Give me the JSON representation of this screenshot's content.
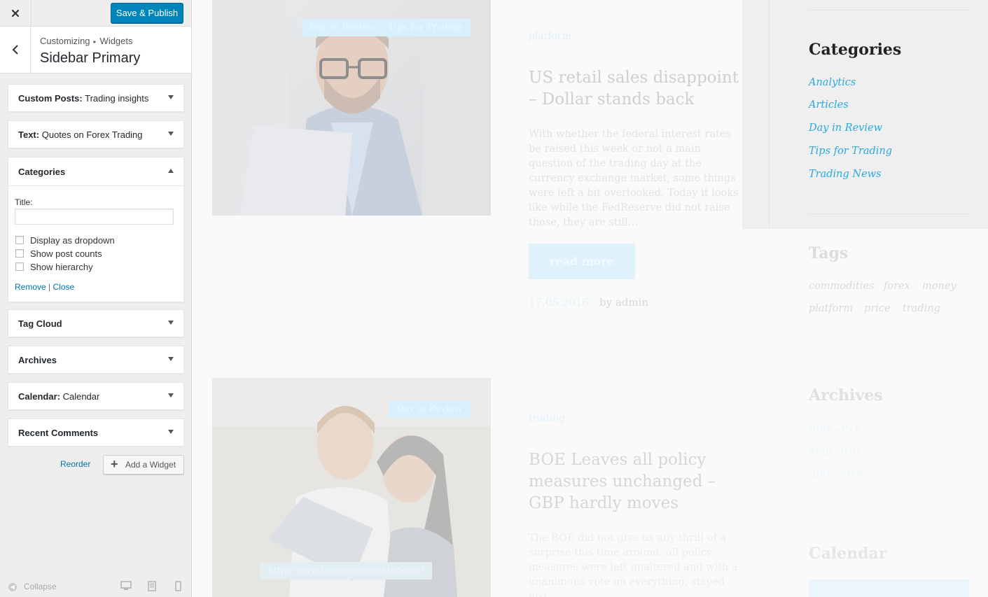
{
  "topbar": {
    "close_icon": "close-icon",
    "publish_label": "Save & Publish"
  },
  "header": {
    "breadcrumb_root": "Customizing",
    "breadcrumb_leaf": "Widgets",
    "title": "Sidebar Primary"
  },
  "widgets": [
    {
      "type": "Custom Posts:",
      "subtitle": " Trading insights"
    },
    {
      "type": "Text:",
      "subtitle": " Quotes on Forex Trading"
    },
    {
      "type": "Categories",
      "subtitle": ""
    },
    {
      "type": "Tag Cloud",
      "subtitle": ""
    },
    {
      "type": "Archives",
      "subtitle": ""
    },
    {
      "type": "Calendar:",
      "subtitle": " Calendar"
    },
    {
      "type": "Recent Comments",
      "subtitle": ""
    }
  ],
  "categories_form": {
    "title_label": "Title:",
    "title_value": "",
    "options": [
      {
        "label": "Display as dropdown",
        "checked": false
      },
      {
        "label": "Show post counts",
        "checked": false
      },
      {
        "label": "Show hierarchy",
        "checked": false
      }
    ],
    "remove_label": "Remove",
    "separator": "|",
    "close_label": "Close"
  },
  "actions": {
    "reorder_label": "Reorder",
    "add_widget_label": "Add a Widget"
  },
  "footer": {
    "collapse_label": "Collapse",
    "devices": [
      "desktop-icon",
      "tablet-icon",
      "mobile-icon"
    ]
  },
  "preview": {
    "post1": {
      "tags": [
        "Day in Review",
        "Tips for Trading"
      ],
      "category": "platform",
      "title": "US retail sales disappoint – Dollar stands back",
      "excerpt": "With whether the federal interest rates be raised this week or not a main question of the trading day at the currency exchange market, some things were left a bit overlooked. Today it looks like while the FedReserve did not raise those, they are still…",
      "read_more": "read more",
      "date": "17.05.2016",
      "author": "by admin"
    },
    "post2": {
      "tags": [
        "Day in Review"
      ],
      "url": "http://www.templatemonster.com/",
      "category": "trading",
      "title": "BOE Leaves all policy measures unchanged – GBP hardly moves",
      "excerpt": "The BOE did not give us any thrill of a surprise this time around: all policy measures were left unaltered and with a unanimous vote on everything, stayed just"
    },
    "sidebar": {
      "categories_heading": "Categories",
      "categories": [
        "Analytics",
        "Articles",
        "Day in Review",
        "Tips for Trading",
        "Trading News"
      ],
      "tags_heading": "Tags",
      "tags": [
        "commodities",
        "forex",
        "money",
        "platform",
        "price",
        "trading"
      ],
      "archives_heading": "Archives",
      "archives": [
        "June 2016",
        "May 2016",
        "April 2016"
      ],
      "calendar_heading": "Calendar"
    }
  },
  "colors": {
    "accent": "#0085ba",
    "link": "#0073aa",
    "preview_link": "#29a9e0"
  }
}
